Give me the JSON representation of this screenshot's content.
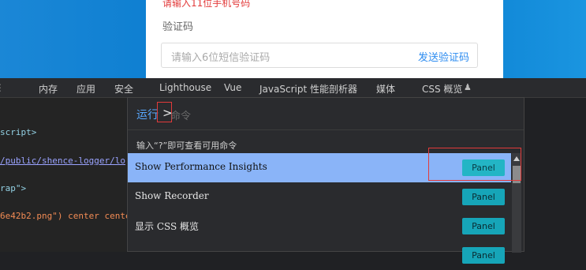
{
  "login": {
    "error_text": "请输入11位手机号码",
    "sms_label": "验证码",
    "sms_placeholder": "请输入6位短信验证码",
    "send_button": "发送验证码"
  },
  "devtools_tabs": [
    "内存",
    "应用",
    "安全",
    "Lighthouse",
    "Vue",
    "JavaScript 性能剖析器",
    "媒体",
    "CSS 概览"
  ],
  "code_lines": [
    {
      "text": "script>",
      "style": "tag"
    },
    {
      "text": "/public/shence-logger/lo",
      "style": "link"
    },
    {
      "text": "rap\">",
      "style": "tag"
    },
    {
      "text": "6e42b2.png\") center cente",
      "style": "str"
    }
  ],
  "palette": {
    "run_label": "运行",
    "gt_symbol": ">",
    "input_placeholder": "命令",
    "hint": "输入“?”即可查看可用命令",
    "commands": [
      {
        "label": "Show Performance Insights",
        "button": "Panel"
      },
      {
        "label": "Show Recorder",
        "button": "Panel"
      },
      {
        "label": "显示 CSS 概览",
        "button": "Panel"
      },
      {
        "label": "",
        "button": "Panel"
      }
    ]
  },
  "colors": {
    "accent_blue": "#58a8ff",
    "selected_row": "#8ab4f8",
    "panel_button": "#16a5b8",
    "highlight_red": "#e23a3a"
  }
}
